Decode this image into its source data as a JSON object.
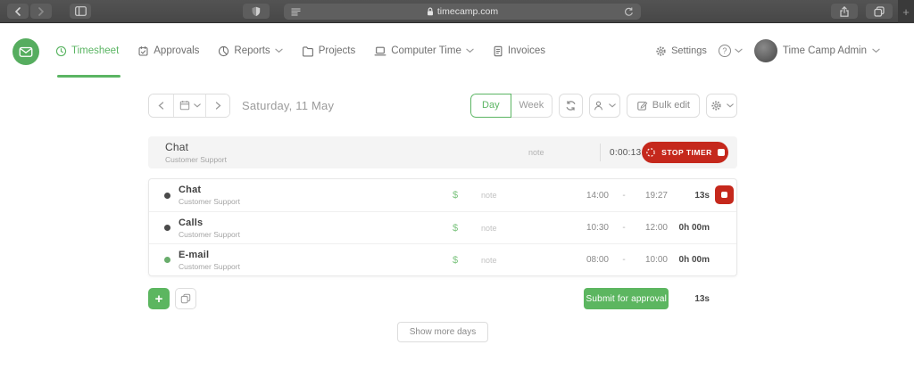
{
  "browser": {
    "url": "timecamp.com",
    "new_tab_glyph": "+"
  },
  "nav": {
    "items": [
      {
        "label": "Timesheet"
      },
      {
        "label": "Approvals"
      },
      {
        "label": "Reports"
      },
      {
        "label": "Projects"
      },
      {
        "label": "Computer Time"
      },
      {
        "label": "Invoices"
      }
    ],
    "settings_label": "Settings",
    "help_glyph": "?",
    "user_name": "Time Camp Admin"
  },
  "toolbar": {
    "date_label": "Saturday, 11 May",
    "day_label": "Day",
    "week_label": "Week",
    "bulk_edit_label": "Bulk edit"
  },
  "timer": {
    "task": "Chat",
    "project": "Customer Support",
    "note": "note",
    "elapsed": "0:00:13",
    "stop_label": "STOP TIMER"
  },
  "entries": [
    {
      "task": "Chat",
      "project": "Customer Support",
      "billable_glyph": "$",
      "note": "note",
      "start": "14:00",
      "separator": "-",
      "end": "19:27",
      "duration": "13s",
      "dot_color": "#4a4a4a"
    },
    {
      "task": "Calls",
      "project": "Customer Support",
      "billable_glyph": "$",
      "note": "note",
      "start": "10:30",
      "separator": "-",
      "end": "12:00",
      "duration": "0h 00m",
      "dot_color": "#4a4a4a"
    },
    {
      "task": "E-mail",
      "project": "Customer Support",
      "billable_glyph": "$",
      "note": "note",
      "start": "08:00",
      "separator": "-",
      "end": "10:00",
      "duration": "0h 00m",
      "dot_color": "#69ad6c"
    }
  ],
  "footer": {
    "add_glyph": "+",
    "submit_label": "Submit for approval",
    "total_duration": "13s",
    "show_more_label": "Show more days"
  },
  "colors": {
    "accent_green": "#5bb563",
    "accent_red": "#c5281c"
  }
}
